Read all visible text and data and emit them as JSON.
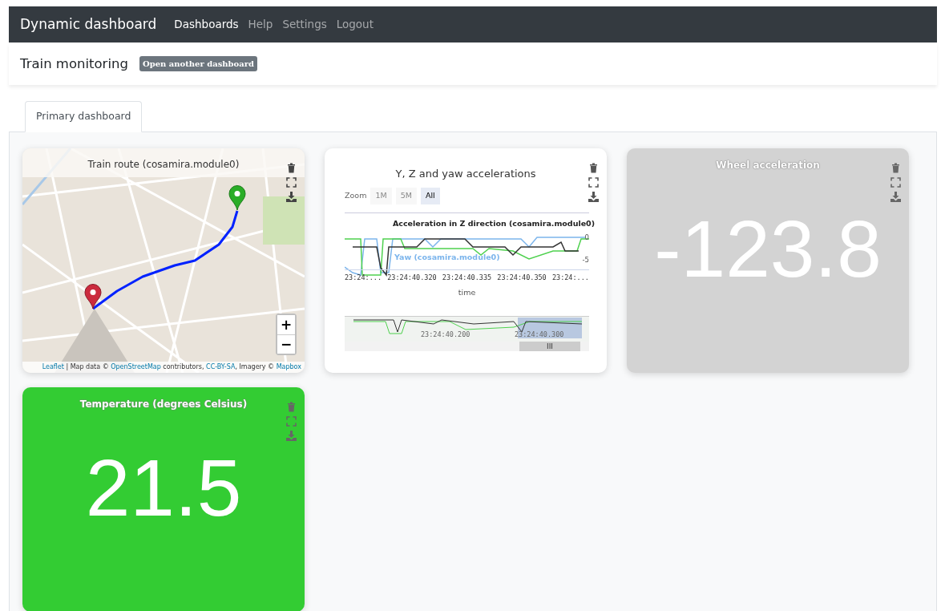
{
  "navbar": {
    "brand": "Dynamic dashboard",
    "links": [
      {
        "label": "Dashboards",
        "selected": true
      },
      {
        "label": "Help",
        "selected": false
      },
      {
        "label": "Settings",
        "selected": false
      },
      {
        "label": "Logout",
        "selected": false
      }
    ]
  },
  "header": {
    "title": "Train monitoring",
    "badge": "Open another dashboard"
  },
  "tabs": [
    {
      "label": "Primary dashboard",
      "selected": true
    }
  ],
  "widgets": [
    {
      "kind": "map",
      "title": "Train route (cosamira.module0)",
      "zoom_in": "+",
      "zoom_out": "−",
      "attribution": [
        {
          "text": "Leaflet",
          "kind": "link"
        },
        {
          "text": " | Map data © ",
          "kind": "text"
        },
        {
          "text": "OpenStreetMap",
          "kind": "link"
        },
        {
          "text": " contributors, ",
          "kind": "text"
        },
        {
          "text": "CC-BY-SA",
          "kind": "link"
        },
        {
          "text": ", Imagery © ",
          "kind": "text"
        },
        {
          "text": "Mapbox",
          "kind": "link"
        }
      ]
    },
    {
      "kind": "chart",
      "title": "Y, Z and yaw accelerations",
      "zoom_label": "Zoom",
      "zoom_buttons": [
        {
          "label": "1M",
          "selected": false,
          "disabled": true
        },
        {
          "label": "5M",
          "selected": false,
          "disabled": true
        },
        {
          "label": "All",
          "selected": true,
          "disabled": false
        }
      ],
      "series_label_top": "Acceleration in Z direction (cosamira.module0)",
      "series_label_bottom": "Yaw (cosamira.module0)",
      "yticks": [
        "0",
        "-5"
      ],
      "xticks": [
        "23:24:...",
        "23:24:40.320",
        "23:24:40.335",
        "23:24:40.350",
        "23:24:..."
      ],
      "xlabel": "time",
      "navigator_ticks": [
        "23:24:40.200",
        "23:24:40.300"
      ],
      "scroll_grip": "III"
    },
    {
      "kind": "value",
      "title": "Wheel acceleration",
      "value": "-123.8",
      "color": "#d3d3d3"
    },
    {
      "kind": "value",
      "title": "Temperature (degrees Celsius)",
      "value": "21.5",
      "color": "#33cc33"
    }
  ]
}
